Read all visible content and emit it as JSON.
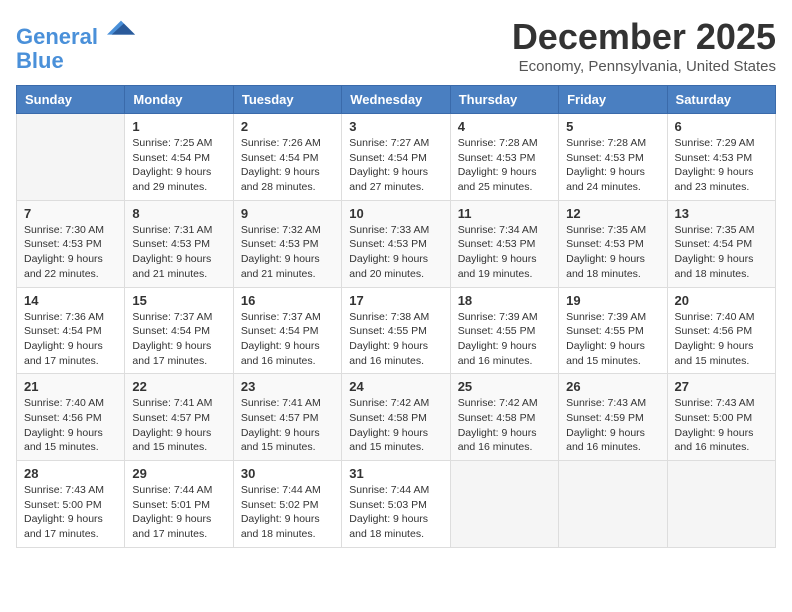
{
  "header": {
    "logo_line1": "General",
    "logo_line2": "Blue",
    "month": "December 2025",
    "location": "Economy, Pennsylvania, United States"
  },
  "days_of_week": [
    "Sunday",
    "Monday",
    "Tuesday",
    "Wednesday",
    "Thursday",
    "Friday",
    "Saturday"
  ],
  "weeks": [
    [
      {
        "day": "",
        "info": ""
      },
      {
        "day": "1",
        "info": "Sunrise: 7:25 AM\nSunset: 4:54 PM\nDaylight: 9 hours\nand 29 minutes."
      },
      {
        "day": "2",
        "info": "Sunrise: 7:26 AM\nSunset: 4:54 PM\nDaylight: 9 hours\nand 28 minutes."
      },
      {
        "day": "3",
        "info": "Sunrise: 7:27 AM\nSunset: 4:54 PM\nDaylight: 9 hours\nand 27 minutes."
      },
      {
        "day": "4",
        "info": "Sunrise: 7:28 AM\nSunset: 4:53 PM\nDaylight: 9 hours\nand 25 minutes."
      },
      {
        "day": "5",
        "info": "Sunrise: 7:28 AM\nSunset: 4:53 PM\nDaylight: 9 hours\nand 24 minutes."
      },
      {
        "day": "6",
        "info": "Sunrise: 7:29 AM\nSunset: 4:53 PM\nDaylight: 9 hours\nand 23 minutes."
      }
    ],
    [
      {
        "day": "7",
        "info": "Sunrise: 7:30 AM\nSunset: 4:53 PM\nDaylight: 9 hours\nand 22 minutes."
      },
      {
        "day": "8",
        "info": "Sunrise: 7:31 AM\nSunset: 4:53 PM\nDaylight: 9 hours\nand 21 minutes."
      },
      {
        "day": "9",
        "info": "Sunrise: 7:32 AM\nSunset: 4:53 PM\nDaylight: 9 hours\nand 21 minutes."
      },
      {
        "day": "10",
        "info": "Sunrise: 7:33 AM\nSunset: 4:53 PM\nDaylight: 9 hours\nand 20 minutes."
      },
      {
        "day": "11",
        "info": "Sunrise: 7:34 AM\nSunset: 4:53 PM\nDaylight: 9 hours\nand 19 minutes."
      },
      {
        "day": "12",
        "info": "Sunrise: 7:35 AM\nSunset: 4:53 PM\nDaylight: 9 hours\nand 18 minutes."
      },
      {
        "day": "13",
        "info": "Sunrise: 7:35 AM\nSunset: 4:54 PM\nDaylight: 9 hours\nand 18 minutes."
      }
    ],
    [
      {
        "day": "14",
        "info": "Sunrise: 7:36 AM\nSunset: 4:54 PM\nDaylight: 9 hours\nand 17 minutes."
      },
      {
        "day": "15",
        "info": "Sunrise: 7:37 AM\nSunset: 4:54 PM\nDaylight: 9 hours\nand 17 minutes."
      },
      {
        "day": "16",
        "info": "Sunrise: 7:37 AM\nSunset: 4:54 PM\nDaylight: 9 hours\nand 16 minutes."
      },
      {
        "day": "17",
        "info": "Sunrise: 7:38 AM\nSunset: 4:55 PM\nDaylight: 9 hours\nand 16 minutes."
      },
      {
        "day": "18",
        "info": "Sunrise: 7:39 AM\nSunset: 4:55 PM\nDaylight: 9 hours\nand 16 minutes."
      },
      {
        "day": "19",
        "info": "Sunrise: 7:39 AM\nSunset: 4:55 PM\nDaylight: 9 hours\nand 15 minutes."
      },
      {
        "day": "20",
        "info": "Sunrise: 7:40 AM\nSunset: 4:56 PM\nDaylight: 9 hours\nand 15 minutes."
      }
    ],
    [
      {
        "day": "21",
        "info": "Sunrise: 7:40 AM\nSunset: 4:56 PM\nDaylight: 9 hours\nand 15 minutes."
      },
      {
        "day": "22",
        "info": "Sunrise: 7:41 AM\nSunset: 4:57 PM\nDaylight: 9 hours\nand 15 minutes."
      },
      {
        "day": "23",
        "info": "Sunrise: 7:41 AM\nSunset: 4:57 PM\nDaylight: 9 hours\nand 15 minutes."
      },
      {
        "day": "24",
        "info": "Sunrise: 7:42 AM\nSunset: 4:58 PM\nDaylight: 9 hours\nand 15 minutes."
      },
      {
        "day": "25",
        "info": "Sunrise: 7:42 AM\nSunset: 4:58 PM\nDaylight: 9 hours\nand 16 minutes."
      },
      {
        "day": "26",
        "info": "Sunrise: 7:43 AM\nSunset: 4:59 PM\nDaylight: 9 hours\nand 16 minutes."
      },
      {
        "day": "27",
        "info": "Sunrise: 7:43 AM\nSunset: 5:00 PM\nDaylight: 9 hours\nand 16 minutes."
      }
    ],
    [
      {
        "day": "28",
        "info": "Sunrise: 7:43 AM\nSunset: 5:00 PM\nDaylight: 9 hours\nand 17 minutes."
      },
      {
        "day": "29",
        "info": "Sunrise: 7:44 AM\nSunset: 5:01 PM\nDaylight: 9 hours\nand 17 minutes."
      },
      {
        "day": "30",
        "info": "Sunrise: 7:44 AM\nSunset: 5:02 PM\nDaylight: 9 hours\nand 18 minutes."
      },
      {
        "day": "31",
        "info": "Sunrise: 7:44 AM\nSunset: 5:03 PM\nDaylight: 9 hours\nand 18 minutes."
      },
      {
        "day": "",
        "info": ""
      },
      {
        "day": "",
        "info": ""
      },
      {
        "day": "",
        "info": ""
      }
    ]
  ]
}
